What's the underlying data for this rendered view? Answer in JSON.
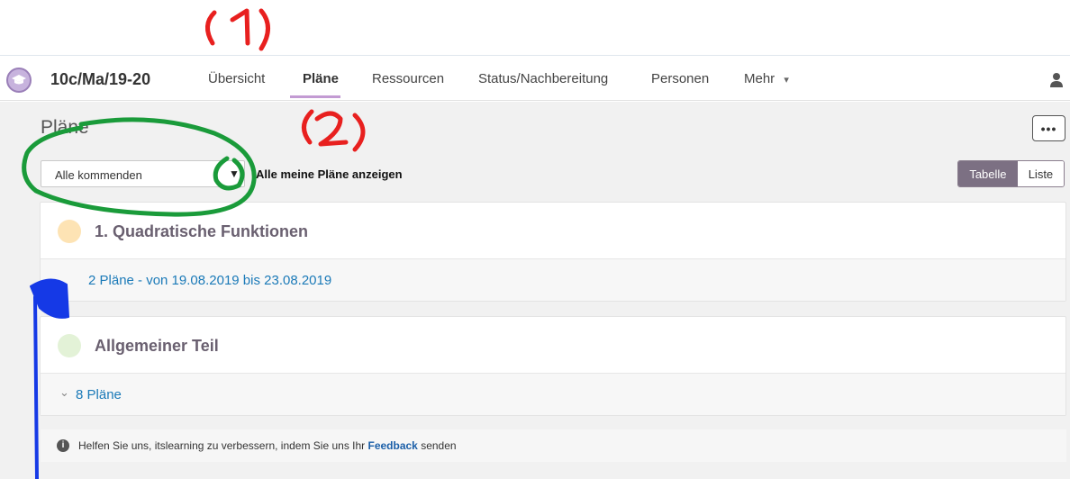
{
  "header": {
    "course_title": "10c/Ma/19-20",
    "nav": [
      {
        "label": "Übersicht"
      },
      {
        "label": "Pläne"
      },
      {
        "label": "Ressourcen"
      },
      {
        "label": "Status/Nachbereitung"
      },
      {
        "label": "Personen"
      },
      {
        "label": "Mehr"
      }
    ],
    "more_arrow": "▾",
    "user_icon": "person-icon"
  },
  "page": {
    "title": "Pläne",
    "more_button": "•••",
    "filter": {
      "selected": "Alle kommenden",
      "arrow": "▼"
    },
    "checkbox_label": "Alle meine Pläne anzeigen",
    "view_toggle": {
      "table": "Tabelle",
      "list": "Liste",
      "active": "Tabelle"
    }
  },
  "cards": [
    {
      "title": "1. Quadratische Funktionen",
      "dot_color": "#fde3b4",
      "link": "2 Pläne - von 19.08.2019 bis 23.08.2019"
    },
    {
      "title": "Allgemeiner Teil",
      "dot_color": "#e3f2d7",
      "link": "8 Pläne",
      "chevron": "⌄"
    }
  ],
  "feedback": {
    "info_icon": "i",
    "before": "Helfen Sie uns, itslearning zu verbessern, indem Sie uns Ihr ",
    "link": "Feedback",
    "after": " senden"
  },
  "annotations": {
    "label_1": "(1)",
    "label_2": "(2)",
    "colors": {
      "red": "#e8201f",
      "green": "#1a9b3a",
      "blue": "#1539e6"
    }
  }
}
